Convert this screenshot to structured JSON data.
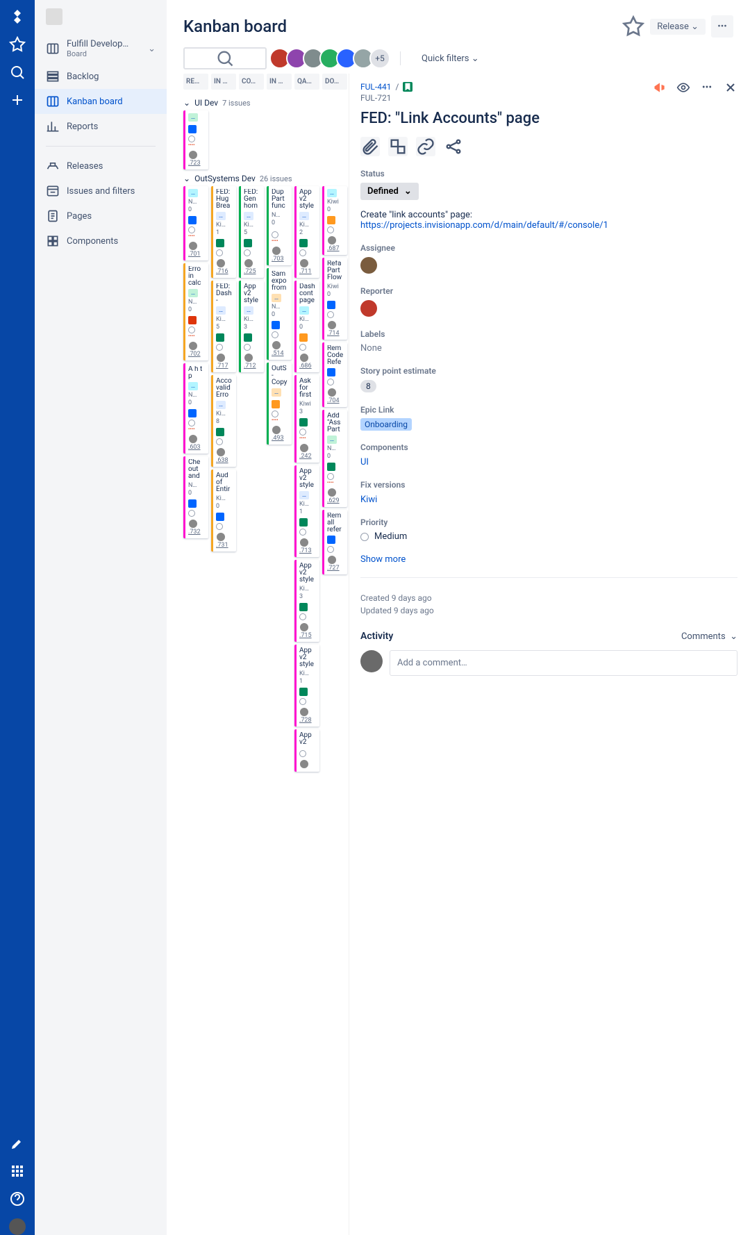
{
  "global_nav": {
    "logo": "jira",
    "icons": [
      "star",
      "search",
      "plus"
    ],
    "bottom": [
      "arrow",
      "apps",
      "help",
      "avatar"
    ]
  },
  "sidebar": {
    "project": {
      "name": "Fulfill Develop…",
      "sub": "Board"
    },
    "items": [
      {
        "icon": "board",
        "label": "Fulfill Develop…",
        "sub": "Board",
        "chev": true
      },
      {
        "icon": "backlog",
        "label": "Backlog"
      },
      {
        "icon": "board",
        "label": "Kanban board",
        "active": true
      },
      {
        "icon": "reports",
        "label": "Reports"
      }
    ],
    "sep": true,
    "items2": [
      {
        "icon": "ship",
        "label": "Releases"
      },
      {
        "icon": "filters",
        "label": "Issues and filters"
      },
      {
        "icon": "page",
        "label": "Pages"
      },
      {
        "icon": "component",
        "label": "Components"
      }
    ]
  },
  "header": {
    "title": "Kanban board",
    "release": "Release",
    "avatars_extra": "+5",
    "quick_filters": "Quick filters"
  },
  "columns": [
    "RE…",
    "IN …",
    "CO…",
    "IN …",
    "QA…",
    "DO…"
  ],
  "swimlanes": [
    {
      "name": "UI Dev",
      "count": "7 issues",
      "cols": [
        [
          {
            "bl": "mag",
            "ep": "green",
            "ttl": "",
            "meta": "",
            "pt": "",
            "dots": "red",
            "key": ".723",
            "t": "t-blue"
          }
        ],
        [],
        [],
        [],
        [],
        []
      ]
    },
    {
      "name": "OutSystems Dev",
      "count": "26 issues",
      "cols": [
        [
          {
            "bl": "mag",
            "ep": "teal",
            "meta": "N…",
            "pt": "0",
            "t": "t-blue",
            "dots": "red",
            "key": ".701",
            "ttl": ""
          },
          {
            "bl": "yel",
            "ttl": "Erro in calc",
            "ep": "green",
            "meta": "N…",
            "pt": "0",
            "t": "t-red",
            "dots": "red",
            "key": ".702"
          },
          {
            "bl": "mag",
            "ttl": "A h t p",
            "ep": "teal",
            "meta": "N…",
            "pt": "0",
            "t": "t-blue",
            "dots": "red",
            "key": ".603"
          },
          {
            "bl": "mag",
            "ttl": "Che out and",
            "meta": "N…",
            "pt": "0",
            "t": "t-blue",
            "key": ".732"
          }
        ],
        [
          {
            "bl": "yel",
            "ttl": "FED: Hug Brea",
            "ep": "blue",
            "meta": "Ki…",
            "pt": "1",
            "t": "t-grn",
            "dots": "",
            "key": ".716"
          },
          {
            "bl": "yel",
            "ttl": "FED: Dash -",
            "ep": "blue",
            "meta": "Ki…",
            "pt": "5",
            "t": "t-grn",
            "dots": "",
            "key": ".717"
          },
          {
            "bl": "yel",
            "ttl": "Acco valid Erro",
            "ep": "blue",
            "meta": "Ki…",
            "pt": "8",
            "t": "t-grn",
            "key": ".638"
          },
          {
            "bl": "yel",
            "ttl": "Aud of Entir",
            "meta": "Ki…",
            "pt": "0",
            "t": "t-blue",
            "key": ".731"
          }
        ],
        [
          {
            "bl": "grn",
            "ttl": "FED: Gen hom",
            "ep": "blue",
            "meta": "Ki…",
            "pt": "5",
            "t": "t-grn",
            "key": ".725"
          },
          {
            "bl": "grn",
            "ttl": "App v2 style",
            "ep": "blue",
            "meta": "Ki…",
            "pt": "3",
            "t": "t-grn",
            "key": ".712"
          }
        ],
        [
          {
            "bl": "grn",
            "ttl": "Dup Part func",
            "meta": "N…",
            "pt": "0",
            "dots": "red",
            "key": ".703"
          },
          {
            "bl": "grn",
            "ttl": "Sam expo from",
            "ep": "orange",
            "meta": "N…",
            "pt": "0",
            "t": "t-blue",
            "dots": "",
            "key": ".514"
          },
          {
            "bl": "grn",
            "ttl": "OutS - Copy",
            "ep": "orange",
            "meta": "",
            "t": "t-org",
            "dots": "red",
            "key": ".493"
          }
        ],
        [
          {
            "bl": "mag",
            "ttl": "App v2 style",
            "ep": "blue",
            "meta": "Ki…",
            "pt": "2",
            "t": "t-grn",
            "key": ".711"
          },
          {
            "bl": "mag",
            "ttl": "Dash cont page",
            "ep": "teal",
            "meta": "Ki…",
            "pt": "0",
            "t": "t-org",
            "key": ".686"
          },
          {
            "bl": "mag",
            "ttl": "Ask for first",
            "meta": "Kiwi",
            "pt": "3",
            "t": "t-grn",
            "dots": "red",
            "key": ".242"
          },
          {
            "bl": "mag",
            "ttl": "App v2 style",
            "ep": "blue",
            "meta": "Ki…",
            "pt": "1",
            "t": "t-grn",
            "key": ".713"
          },
          {
            "bl": "mag",
            "ttl": "App v2 style",
            "meta": "Ki…",
            "pt": "3",
            "t": "t-grn",
            "key": ".715"
          },
          {
            "bl": "mag",
            "ttl": "App v2 style",
            "meta": "Ki…",
            "pt": "1",
            "t": "t-grn",
            "key": ".728"
          },
          {
            "bl": "mag",
            "ttl": "App v2",
            "meta": "",
            "pt": "",
            "key": ""
          }
        ],
        [
          {
            "bl": "mag",
            "ep": "teal",
            "meta": "Kiwi",
            "pt": "0",
            "t": "t-org",
            "key": ".687",
            "ttl": ""
          },
          {
            "bl": "mag",
            "ttl": "Refa Part Flow",
            "meta": "Kiwi",
            "pt": "0",
            "t": "t-blue",
            "key": ".714"
          },
          {
            "bl": "mag",
            "ttl": "Rem Code Refe",
            "meta": "",
            "t": "t-blue",
            "key": ".704"
          },
          {
            "bl": "mag",
            "ttl": "Add \"Ass Part",
            "ep": "green",
            "meta": "N…",
            "pt": "0",
            "t": "t-grn",
            "dots": "red",
            "key": ".629"
          },
          {
            "bl": "mag",
            "ttl": "Rem all refer",
            "meta": "",
            "t": "t-blue",
            "key": ".727"
          }
        ]
      ]
    }
  ],
  "detail": {
    "breadcrumb": {
      "parent": "FUL-441",
      "child": "FUL-721"
    },
    "title": "FED: \"Link Accounts\" page",
    "status": {
      "label": "Status",
      "value": "Defined"
    },
    "description": {
      "text": "Create \"link accounts\" page:",
      "link": "https://projects.invisionapp.com/d/main/default/#/console/1"
    },
    "assignee": {
      "label": "Assignee",
      "name": ""
    },
    "reporter": {
      "label": "Reporter",
      "name": ""
    },
    "labels": {
      "label": "Labels",
      "value": "None"
    },
    "story_points": {
      "label": "Story point estimate",
      "value": "8"
    },
    "epic": {
      "label": "Epic Link",
      "value": "Onboarding"
    },
    "components": {
      "label": "Components",
      "value": "UI"
    },
    "fix": {
      "label": "Fix versions",
      "value": "Kiwi"
    },
    "priority": {
      "label": "Priority",
      "value": "Medium"
    },
    "show_more": "Show more",
    "created": "Created 9 days ago",
    "updated": "Updated 9 days ago",
    "activity": {
      "label": "Activity",
      "selector": "Comments",
      "placeholder": "Add a comment…"
    }
  }
}
